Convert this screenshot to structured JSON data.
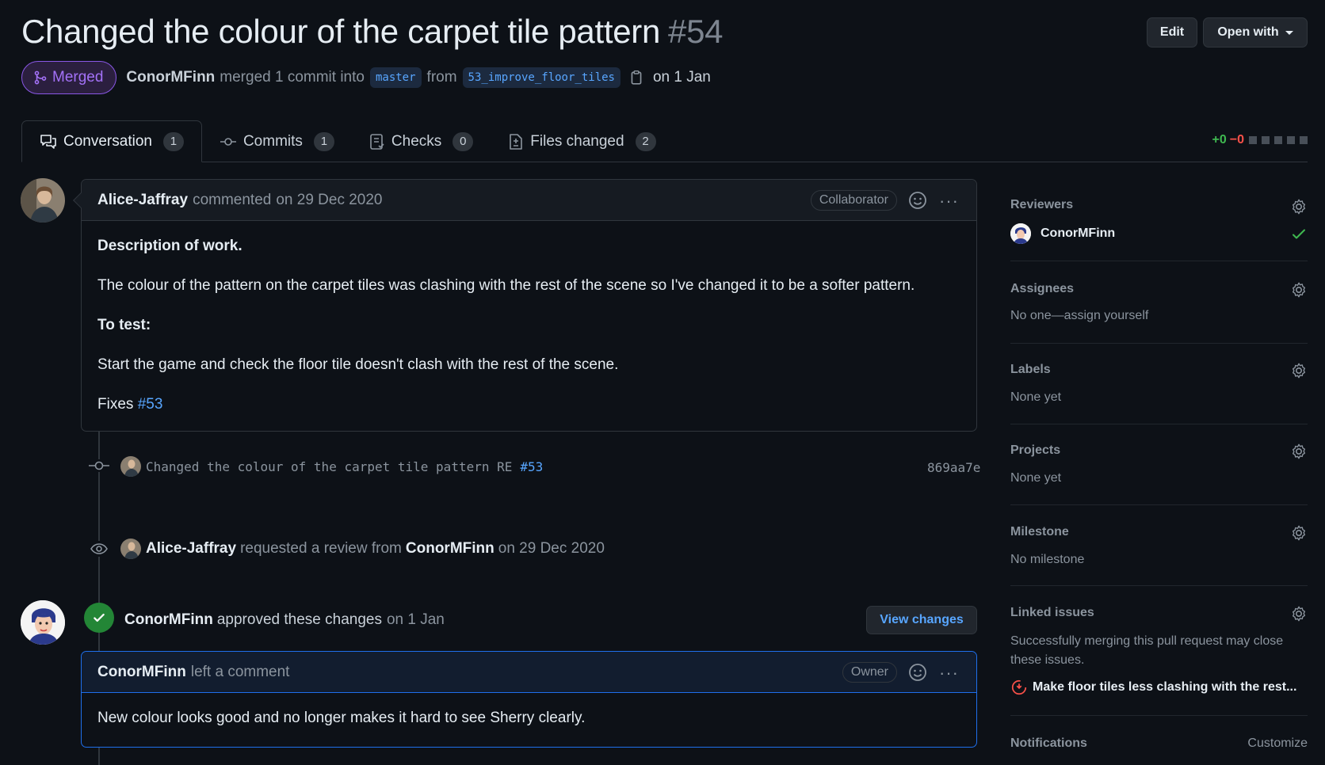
{
  "pr": {
    "title": "Changed the colour of the carpet tile pattern",
    "number": "#54",
    "state": "Merged",
    "merged_by": "ConorMFinn",
    "merge_text": "merged 1 commit into",
    "base_branch": "master",
    "from_text": "from",
    "head_branch": "53_improve_floor_tiles",
    "date_text": "on 1 Jan"
  },
  "header_buttons": {
    "edit": "Edit",
    "open_with": "Open with"
  },
  "tabs": [
    {
      "label": "Conversation",
      "count": "1",
      "icon": "comment-discussion-icon"
    },
    {
      "label": "Commits",
      "count": "1",
      "icon": "git-commit-icon"
    },
    {
      "label": "Checks",
      "count": "0",
      "icon": "checklist-icon"
    },
    {
      "label": "Files changed",
      "count": "2",
      "icon": "file-diff-icon"
    }
  ],
  "diffstat": {
    "additions": "+0",
    "deletions": "−0"
  },
  "comment1": {
    "author": "Alice-Jaffray",
    "action": "commented",
    "date": "on 29 Dec 2020",
    "role": "Collaborator",
    "heading": "Description of work.",
    "description": "The colour of the pattern on the carpet tiles was clashing with the rest of the scene so I've changed it to be a softer pattern.",
    "test_heading": "To test:",
    "test_text": "Start the game and check the floor tile doesn't clash with the rest of the scene.",
    "fixes_label": "Fixes",
    "fixes_ref": "#53"
  },
  "commit_event": {
    "message": "Changed the colour of the carpet tile pattern RE",
    "ref": "#53",
    "sha": "869aa7e"
  },
  "review_request": {
    "actor": "Alice-Jaffray",
    "text": "requested a review from",
    "reviewer": "ConorMFinn",
    "date": "on 29 Dec 2020"
  },
  "approval": {
    "actor": "ConorMFinn",
    "text": "approved these changes",
    "date": "on 1 Jan",
    "button": "View changes"
  },
  "comment2": {
    "author": "ConorMFinn",
    "action": "left a comment",
    "role": "Owner",
    "body": "New colour looks good and no longer makes it hard to see Sherry clearly."
  },
  "sidebar": {
    "reviewers": {
      "title": "Reviewers",
      "name": "ConorMFinn"
    },
    "assignees": {
      "title": "Assignees",
      "value": "No one—assign yourself"
    },
    "labels": {
      "title": "Labels",
      "value": "None yet"
    },
    "projects": {
      "title": "Projects",
      "value": "None yet"
    },
    "milestone": {
      "title": "Milestone",
      "value": "No milestone"
    },
    "linked_issues": {
      "title": "Linked issues",
      "description": "Successfully merging this pull request may close these issues.",
      "issue": "Make floor tiles less clashing with the rest..."
    },
    "notifications": {
      "title": "Notifications",
      "action": "Customize"
    }
  },
  "colors": {
    "background": "#0d1117",
    "merged_purple": "#a371f7",
    "link_blue": "#58a6ff",
    "success_green": "#238636",
    "danger_red": "#f85149"
  }
}
